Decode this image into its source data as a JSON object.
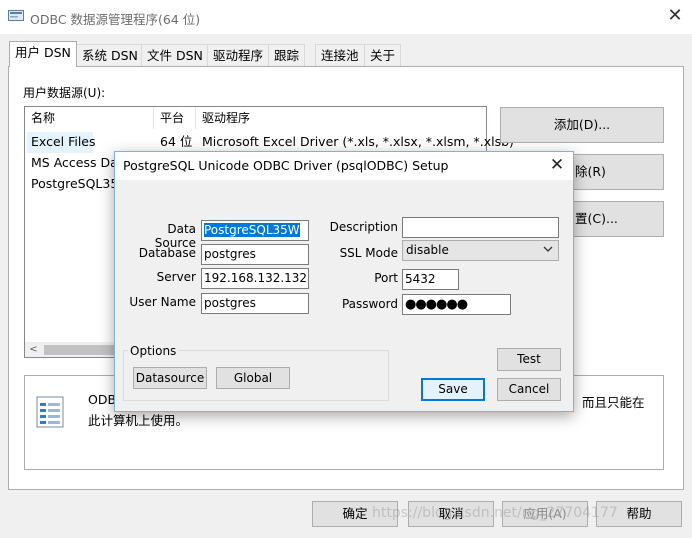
{
  "window": {
    "title": "ODBC 数据源管理程序(64 位)",
    "close": "✕"
  },
  "tabs": [
    {
      "label": "用户 DSN"
    },
    {
      "label": "系统 DSN"
    },
    {
      "label": "文件 DSN"
    },
    {
      "label": "驱动程序"
    },
    {
      "label": "跟踪"
    },
    {
      "label": "连接池"
    },
    {
      "label": "关于"
    }
  ],
  "user_dsn": {
    "section_label": "用户数据源(U):",
    "columns": [
      "名称",
      "平台",
      "驱动程序"
    ],
    "rows": [
      {
        "name": "Excel Files",
        "platform": "64 位",
        "driver": "Microsoft Excel Driver (*.xls, *.xlsx, *.xlsm, *.xlsb)"
      },
      {
        "name": "MS Access Dat"
      },
      {
        "name": "PostgreSQL35"
      }
    ],
    "scroll_left": "<",
    "buttons": {
      "add": "添加(D)...",
      "remove": "除(R)",
      "configure": "置(C)..."
    },
    "info_text_line1": "ODB",
    "info_text_line1_right": "而且只能在",
    "info_text_line2": "此计算机上使用。"
  },
  "footer": {
    "ok": "确定",
    "cancel": "取消",
    "apply": "应用(A)",
    "help": "帮助"
  },
  "watermark": "https://blog.csdn.net/ng_27704177",
  "setup_dialog": {
    "title": "PostgreSQL Unicode ODBC Driver (psqlODBC) Setup",
    "close": "✕",
    "fields": {
      "data_source_label": "Data Source",
      "data_source_value": "PostgreSQL35W",
      "database_label": "Database",
      "database_value": "postgres",
      "server_label": "Server",
      "server_value": "192.168.132.132",
      "username_label": "User Name",
      "username_value": "postgres",
      "description_label": "Description",
      "description_value": "",
      "sslmode_label": "SSL Mode",
      "sslmode_value": "disable",
      "port_label": "Port",
      "port_value": "5432",
      "password_label": "Password",
      "password_value": "●●●●●●"
    },
    "options": {
      "label": "Options",
      "datasource_button": "Datasource",
      "global_button": "Global"
    },
    "buttons": {
      "test": "Test",
      "save": "Save",
      "cancel": "Cancel"
    }
  }
}
